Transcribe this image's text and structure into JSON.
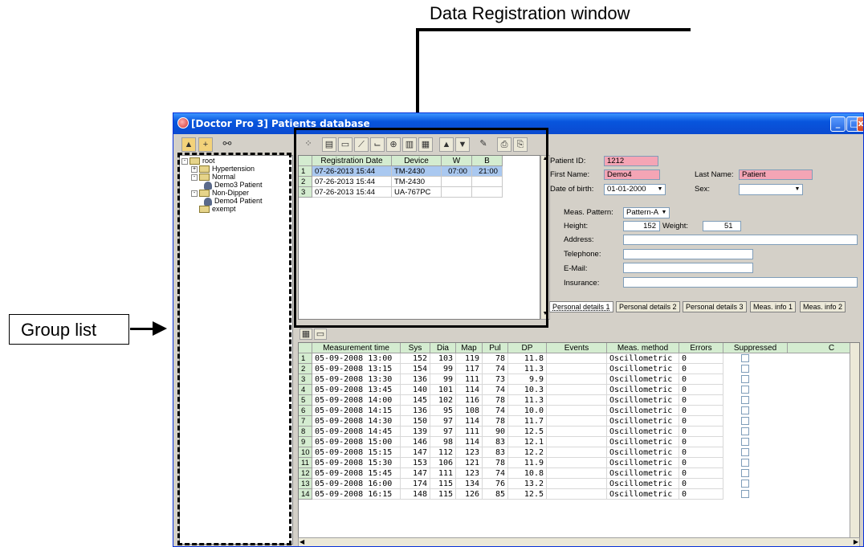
{
  "callouts": {
    "data_registration": "Data Registration window",
    "group_list": "Group list"
  },
  "window": {
    "title": "[Doctor Pro 3] Patients database"
  },
  "tree": {
    "items": [
      {
        "label": "root",
        "kind": "folder",
        "expander": "-"
      },
      {
        "label": "Hypertension",
        "kind": "folder",
        "expander": "+"
      },
      {
        "label": "Normal",
        "kind": "folder",
        "expander": "-"
      },
      {
        "label": "Demo3 Patient",
        "kind": "patient",
        "expander": ""
      },
      {
        "label": "Non-Dipper",
        "kind": "folder",
        "expander": "-"
      },
      {
        "label": "Demo4 Patient",
        "kind": "patient",
        "expander": ""
      },
      {
        "label": "exempt",
        "kind": "folder",
        "expander": ""
      }
    ]
  },
  "registration": {
    "headers": [
      "Registration Date",
      "Device",
      "W",
      "B"
    ],
    "rows": [
      {
        "num": "1",
        "date": "07-26-2013 15:44",
        "device": "TM-2430",
        "w": "07:00",
        "b": "21:00"
      },
      {
        "num": "2",
        "date": "07-26-2013 15:44",
        "device": "TM-2430",
        "w": "",
        "b": ""
      },
      {
        "num": "3",
        "date": "07-26-2013 15:44",
        "device": "UA-767PC",
        "w": "",
        "b": ""
      }
    ],
    "toolbar_icons": [
      "grid-view-icon",
      "list-icon",
      "chart-icon",
      "trend-icon",
      "line-chart-icon",
      "target-icon",
      "histogram-icon",
      "table-icon",
      "up-arrow-icon",
      "down-arrow-icon",
      "eraser-icon",
      "report-icon",
      "print-icon"
    ]
  },
  "patient": {
    "id_label": "Patient ID:",
    "id_value": "1212",
    "first_name_label": "First Name:",
    "first_name_value": "Demo4",
    "last_name_label": "Last Name:",
    "last_name_value": "Patient",
    "dob_label": "Date of birth:",
    "dob_value": "01-01-2000",
    "sex_label": "Sex:",
    "sex_value": "",
    "meas_pattern_label": "Meas. Pattern:",
    "meas_pattern_value": "Pattern-A",
    "height_label": "Height:",
    "height_value": "152",
    "weight_label": "Weight:",
    "weight_value": "51",
    "address_label": "Address:",
    "address_value": "",
    "telephone_label": "Telephone:",
    "telephone_value": "",
    "email_label": "E-Mail:",
    "email_value": "",
    "insurance_label": "Insurance:",
    "insurance_value": "",
    "tabs": [
      "Personal details 1",
      "Personal details 2",
      "Personal details 3",
      "Meas. info 1",
      "Meas. info 2"
    ]
  },
  "measurements": {
    "headers": [
      "Measurement time",
      "Sys",
      "Dia",
      "Map",
      "Pul",
      "DP",
      "Events",
      "Meas. method",
      "Errors",
      "Suppressed",
      "C"
    ],
    "rows": [
      [
        "1",
        "05-09-2008 13:00",
        "152",
        "103",
        "119",
        "78",
        "11.8",
        "",
        "Oscillometric",
        "0"
      ],
      [
        "2",
        "05-09-2008 13:15",
        "154",
        "99",
        "117",
        "74",
        "11.3",
        "",
        "Oscillometric",
        "0"
      ],
      [
        "3",
        "05-09-2008 13:30",
        "136",
        "99",
        "111",
        "73",
        "9.9",
        "",
        "Oscillometric",
        "0"
      ],
      [
        "4",
        "05-09-2008 13:45",
        "140",
        "101",
        "114",
        "74",
        "10.3",
        "",
        "Oscillometric",
        "0"
      ],
      [
        "5",
        "05-09-2008 14:00",
        "145",
        "102",
        "116",
        "78",
        "11.3",
        "",
        "Oscillometric",
        "0"
      ],
      [
        "6",
        "05-09-2008 14:15",
        "136",
        "95",
        "108",
        "74",
        "10.0",
        "",
        "Oscillometric",
        "0"
      ],
      [
        "7",
        "05-09-2008 14:30",
        "150",
        "97",
        "114",
        "78",
        "11.7",
        "",
        "Oscillometric",
        "0"
      ],
      [
        "8",
        "05-09-2008 14:45",
        "139",
        "97",
        "111",
        "90",
        "12.5",
        "",
        "Oscillometric",
        "0"
      ],
      [
        "9",
        "05-09-2008 15:00",
        "146",
        "98",
        "114",
        "83",
        "12.1",
        "",
        "Oscillometric",
        "0"
      ],
      [
        "10",
        "05-09-2008 15:15",
        "147",
        "112",
        "123",
        "83",
        "12.2",
        "",
        "Oscillometric",
        "0"
      ],
      [
        "11",
        "05-09-2008 15:30",
        "153",
        "106",
        "121",
        "78",
        "11.9",
        "",
        "Oscillometric",
        "0"
      ],
      [
        "12",
        "05-09-2008 15:45",
        "147",
        "111",
        "123",
        "74",
        "10.8",
        "",
        "Oscillometric",
        "0"
      ],
      [
        "13",
        "05-09-2008 16:00",
        "174",
        "115",
        "134",
        "76",
        "13.2",
        "",
        "Oscillometric",
        "0"
      ],
      [
        "14",
        "05-09-2008 16:15",
        "148",
        "115",
        "126",
        "85",
        "12.5",
        "",
        "Oscillometric",
        "0"
      ]
    ]
  },
  "colors": {
    "selected_row": "#a9c8f0",
    "header_green": "#d4ecd0",
    "required_field": "#f4a5b5"
  }
}
